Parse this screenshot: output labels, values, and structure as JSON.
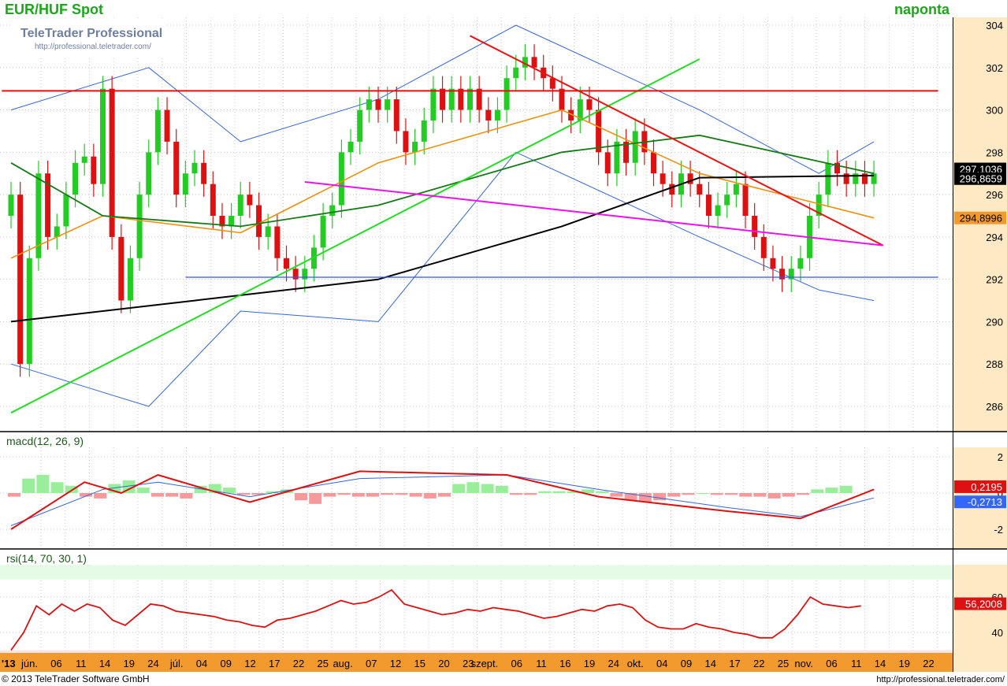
{
  "header": {
    "title": "EUR/HUF Spot",
    "period": "naponta"
  },
  "watermark": {
    "line1": "TeleTrader Professional",
    "line2": "http://professional.teletrader.com/"
  },
  "footer": {
    "copyright": "© 2013 TeleTrader Software GmbH",
    "url": "http://professional.teletrader.com/"
  },
  "colors": {
    "up": "#22cc22",
    "down": "#dd1111",
    "axis_bg": "#fde9c4",
    "date_axis_bg": "#f39a2e"
  },
  "chart_data": [
    {
      "type": "candlestick",
      "title": "EUR/HUF Spot",
      "ylim": [
        285,
        304
      ],
      "yticks": [
        286,
        288,
        290,
        292,
        294,
        296,
        298,
        300,
        302,
        304
      ],
      "date_year_label": "'13",
      "x_tick_labels": [
        "jún.",
        "06",
        "11",
        "14",
        "19",
        "24",
        "júl.",
        "04",
        "09",
        "12",
        "17",
        "22",
        "25",
        "aug.",
        "07",
        "12",
        "15",
        "20",
        "23",
        "szept.",
        "06",
        "11",
        "16",
        "19",
        "24",
        "okt.",
        "04",
        "09",
        "14",
        "17",
        "22",
        "25",
        "nov.",
        "06",
        "11",
        "14",
        "19",
        "22"
      ],
      "close": [
        296.0,
        288.0,
        293.0,
        297.0,
        294.0,
        294.5,
        296.0,
        297.5,
        297.8,
        296.5,
        301.0,
        294.0,
        291.0,
        293.0,
        296.0,
        298.0,
        300.0,
        298.5,
        296.0,
        297.0,
        297.5,
        296.5,
        295.0,
        294.5,
        295.0,
        296.0,
        295.5,
        294.0,
        294.5,
        293.0,
        292.5,
        292.0,
        292.5,
        293.5,
        295.0,
        295.5,
        298.0,
        298.5,
        300.0,
        300.5,
        300.0,
        300.5,
        299.0,
        298.0,
        298.5,
        299.5,
        301.0,
        300.0,
        301.0,
        300.0,
        301.0,
        300.0,
        299.5,
        300.0,
        301.5,
        302.0,
        302.5,
        302.0,
        301.5,
        301.0,
        300.0,
        299.5,
        300.5,
        300.0,
        298.0,
        297.0,
        298.5,
        297.5,
        299.0,
        298.0,
        297.0,
        296.5,
        296.0,
        297.0,
        296.5,
        296.0,
        295.0,
        295.5,
        296.0,
        296.5,
        295.0,
        294.0,
        293.0,
        292.5,
        292.0,
        292.5,
        293.0,
        295.0,
        296.0,
        297.5,
        297.0,
        296.5,
        297.0,
        296.5,
        297.0
      ],
      "ma_black": [
        {
          "x": 0,
          "y": 290.0
        },
        {
          "x": 20,
          "y": 291.0
        },
        {
          "x": 40,
          "y": 292.0
        },
        {
          "x": 60,
          "y": 294.5
        },
        {
          "x": 75,
          "y": 296.8
        },
        {
          "x": 94,
          "y": 296.9
        }
      ],
      "ma_green": [
        {
          "x": 0,
          "y": 297.5
        },
        {
          "x": 10,
          "y": 295.0
        },
        {
          "x": 25,
          "y": 294.5
        },
        {
          "x": 40,
          "y": 295.5
        },
        {
          "x": 60,
          "y": 298.0
        },
        {
          "x": 75,
          "y": 298.8
        },
        {
          "x": 94,
          "y": 297.0
        }
      ],
      "ma_orange": [
        {
          "x": 0,
          "y": 293.0
        },
        {
          "x": 10,
          "y": 295.0
        },
        {
          "x": 25,
          "y": 294.2
        },
        {
          "x": 40,
          "y": 297.5
        },
        {
          "x": 60,
          "y": 300.0
        },
        {
          "x": 75,
          "y": 297.0
        },
        {
          "x": 94,
          "y": 294.9
        }
      ],
      "bollinger_upper": [
        {
          "x": 0,
          "y": 300.0
        },
        {
          "x": 15,
          "y": 302.0
        },
        {
          "x": 25,
          "y": 298.5
        },
        {
          "x": 40,
          "y": 300.5
        },
        {
          "x": 55,
          "y": 304.0
        },
        {
          "x": 75,
          "y": 300.0
        },
        {
          "x": 88,
          "y": 297.0
        },
        {
          "x": 94,
          "y": 298.5
        }
      ],
      "bollinger_lower": [
        {
          "x": 0,
          "y": 288.0
        },
        {
          "x": 15,
          "y": 286.0
        },
        {
          "x": 25,
          "y": 290.5
        },
        {
          "x": 40,
          "y": 290.0
        },
        {
          "x": 55,
          "y": 298.0
        },
        {
          "x": 75,
          "y": 294.0
        },
        {
          "x": 88,
          "y": 291.5
        },
        {
          "x": 94,
          "y": 291.0
        }
      ],
      "trendlines": [
        {
          "color": "#22dd22",
          "x1": 0,
          "y1": 285.7,
          "x2": 75,
          "y2": 302.4
        },
        {
          "color": "#ee1111",
          "x1": 50,
          "y1": 303.5,
          "x2": 95,
          "y2": 293.6
        },
        {
          "color": "#ee11ee",
          "x1": 32,
          "y1": 296.6,
          "x2": 95,
          "y2": 293.6
        },
        {
          "color": "#dd1111",
          "x1": -1,
          "y1": 300.9,
          "x2": 101,
          "y2": 300.9
        },
        {
          "color": "#3355ff",
          "x1": 19,
          "y1": 292.1,
          "x2": 101,
          "y2": 292.1
        }
      ],
      "last_labels": [
        {
          "text": "297,1036",
          "value": 297.1,
          "bg": "#000000",
          "fg": "#ffffff"
        },
        {
          "text": "296,8659",
          "value": 296.87,
          "bg": "#000000",
          "fg": "#ffffff"
        },
        {
          "text": "294,8996",
          "value": 294.9,
          "bg": "#f39a2e",
          "fg": "#000000"
        }
      ]
    },
    {
      "type": "macd",
      "title": "macd(12, 26, 9)",
      "ylim": [
        -2.5,
        2.5
      ],
      "yticks": [
        2,
        0,
        -2
      ],
      "macd": [
        {
          "x": 0,
          "y": -2.0
        },
        {
          "x": 8,
          "y": 0.6
        },
        {
          "x": 12,
          "y": 0.0
        },
        {
          "x": 16,
          "y": 1.0
        },
        {
          "x": 26,
          "y": -0.5
        },
        {
          "x": 38,
          "y": 1.2
        },
        {
          "x": 54,
          "y": 1.0
        },
        {
          "x": 64,
          "y": -0.2
        },
        {
          "x": 78,
          "y": -1.0
        },
        {
          "x": 86,
          "y": -1.4
        },
        {
          "x": 94,
          "y": 0.2
        }
      ],
      "signal": [
        {
          "x": 0,
          "y": -1.8
        },
        {
          "x": 10,
          "y": 0.2
        },
        {
          "x": 16,
          "y": 0.6
        },
        {
          "x": 26,
          "y": -0.2
        },
        {
          "x": 38,
          "y": 0.8
        },
        {
          "x": 54,
          "y": 1.0
        },
        {
          "x": 64,
          "y": 0.2
        },
        {
          "x": 78,
          "y": -0.8
        },
        {
          "x": 86,
          "y": -1.3
        },
        {
          "x": 94,
          "y": -0.27
        }
      ],
      "histogram": [
        -0.2,
        0.8,
        1.0,
        0.6,
        0.4,
        -0.2,
        -0.3,
        0.5,
        0.7,
        0.3,
        -0.2,
        -0.2,
        -0.3,
        0.4,
        0.5,
        0.3,
        -0.1,
        -0.1,
        0.1,
        0.2,
        -0.4,
        -0.6,
        -0.2,
        -0.1,
        -0.2,
        -0.2,
        -0.1,
        -0.1,
        -0.2,
        -0.3,
        -0.2,
        0.5,
        0.6,
        0.5,
        0.4,
        -0.1,
        -0.1,
        0.1,
        0.1,
        0.1,
        0.2,
        0.1,
        -0.2,
        -0.4,
        -0.5,
        -0.4,
        -0.2,
        -0.1,
        0.0,
        -0.1,
        -0.1,
        -0.2,
        -0.2,
        -0.3,
        -0.2,
        -0.1,
        0.2,
        0.3,
        0.4
      ],
      "last_labels": [
        {
          "text": "0,2195",
          "value": 0.22,
          "bg": "#dd1111",
          "fg": "#ffffff"
        },
        {
          "text": "-0,2713",
          "value": -0.27,
          "bg": "#3366ff",
          "fg": "#ffffff"
        }
      ]
    },
    {
      "type": "rsi",
      "title": "rsi(14, 70, 30, 1)",
      "ylim": [
        30,
        78
      ],
      "yticks": [
        60,
        40
      ],
      "zones": {
        "upper": 70,
        "lower": 30
      },
      "values": [
        30,
        40,
        55,
        50,
        56,
        52,
        56,
        54,
        47,
        44,
        50,
        56,
        55,
        52,
        51,
        50,
        49,
        47,
        46,
        44,
        43,
        47,
        48,
        50,
        52,
        55,
        58,
        56,
        57,
        60,
        64,
        56,
        54,
        52,
        50,
        51,
        53,
        52,
        54,
        53,
        52,
        50,
        48,
        49,
        51,
        53,
        52,
        55,
        56,
        54,
        47,
        43,
        42,
        42,
        45,
        43,
        42,
        40,
        39,
        37,
        37,
        42,
        50,
        60,
        56,
        55,
        54,
        55
      ],
      "last_labels": [
        {
          "text": "56,2008",
          "value": 56.2,
          "bg": "#dd1111",
          "fg": "#ffffff"
        }
      ]
    }
  ]
}
